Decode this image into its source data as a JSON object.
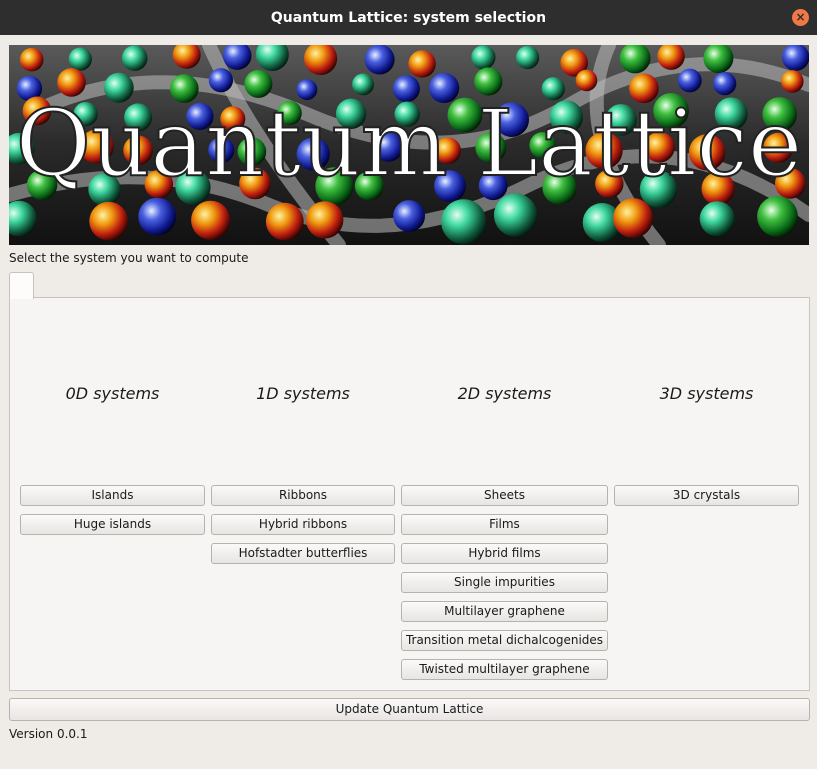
{
  "window": {
    "title": "Quantum Lattice: system selection",
    "close_glyph": "×"
  },
  "banner": {
    "text": "Quantum Lattice"
  },
  "prompt": "Select the system you want to compute",
  "columns": [
    {
      "heading": "0D systems",
      "buttons": [
        "Islands",
        "Huge islands"
      ]
    },
    {
      "heading": "1D systems",
      "buttons": [
        "Ribbons",
        "Hybrid ribbons",
        "Hofstadter butterflies"
      ]
    },
    {
      "heading": "2D systems",
      "buttons": [
        "Sheets",
        "Films",
        "Hybrid films",
        "Single impurities",
        "Multilayer graphene",
        "Transition metal dichalcogenides",
        "Twisted multilayer graphene"
      ]
    },
    {
      "heading": "3D systems",
      "buttons": [
        "3D crystals"
      ]
    }
  ],
  "update_button": "Update Quantum Lattice",
  "version": "Version 0.0.1"
}
